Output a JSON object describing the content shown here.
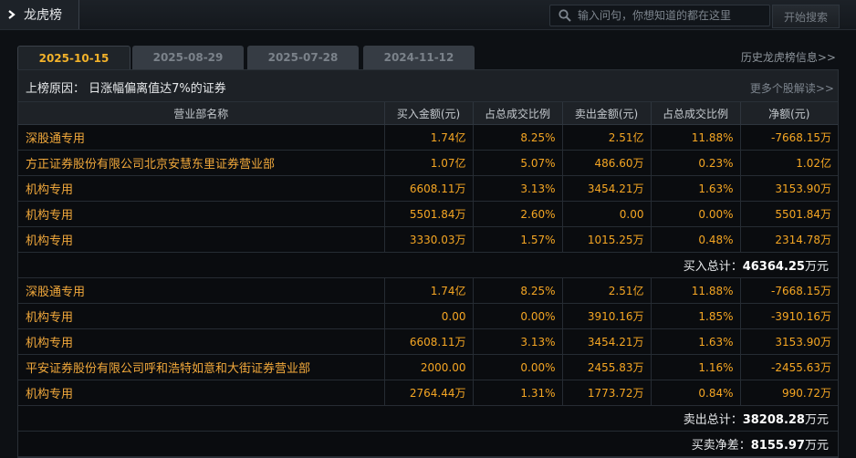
{
  "header": {
    "title": "龙虎榜",
    "search_placeholder": "输入问句，你想知道的都在这里",
    "search_button": "开始搜索"
  },
  "tabs": [
    {
      "label": "2025-10-15",
      "active": true
    },
    {
      "label": "2025-08-29",
      "active": false
    },
    {
      "label": "2025-07-28",
      "active": false
    },
    {
      "label": "2024-11-12",
      "active": false
    }
  ],
  "history_link": "历史龙虎榜信息>>",
  "reason": "上榜原因： 日涨幅偏离值达7%的证券",
  "more_link": "更多个股解读>>",
  "columns": [
    "营业部名称",
    "买入金额(元)",
    "占总成交比例",
    "卖出金额(元)",
    "占总成交比例",
    "净额(元)"
  ],
  "buy_rows": [
    {
      "name": "深股通专用",
      "buy": "1.74亿",
      "buy_pct": "8.25%",
      "sell": "2.51亿",
      "sell_pct": "11.88%",
      "net": "-7668.15万"
    },
    {
      "name": "方正证券股份有限公司北京安慧东里证券营业部",
      "buy": "1.07亿",
      "buy_pct": "5.07%",
      "sell": "486.60万",
      "sell_pct": "0.23%",
      "net": "1.02亿"
    },
    {
      "name": "机构专用",
      "buy": "6608.11万",
      "buy_pct": "3.13%",
      "sell": "3454.21万",
      "sell_pct": "1.63%",
      "net": "3153.90万"
    },
    {
      "name": "机构专用",
      "buy": "5501.84万",
      "buy_pct": "2.60%",
      "sell": "0.00",
      "sell_pct": "0.00%",
      "net": "5501.84万"
    },
    {
      "name": "机构专用",
      "buy": "3330.03万",
      "buy_pct": "1.57%",
      "sell": "1015.25万",
      "sell_pct": "0.48%",
      "net": "2314.78万"
    }
  ],
  "buy_total": {
    "label": "买入总计：",
    "value": "46364.25",
    "unit": "万元"
  },
  "sell_rows": [
    {
      "name": "深股通专用",
      "buy": "1.74亿",
      "buy_pct": "8.25%",
      "sell": "2.51亿",
      "sell_pct": "11.88%",
      "net": "-7668.15万"
    },
    {
      "name": "机构专用",
      "buy": "0.00",
      "buy_pct": "0.00%",
      "sell": "3910.16万",
      "sell_pct": "1.85%",
      "net": "-3910.16万"
    },
    {
      "name": "机构专用",
      "buy": "6608.11万",
      "buy_pct": "3.13%",
      "sell": "3454.21万",
      "sell_pct": "1.63%",
      "net": "3153.90万"
    },
    {
      "name": "平安证券股份有限公司呼和浩特如意和大街证券营业部",
      "buy": "2000.00",
      "buy_pct": "0.00%",
      "sell": "2455.83万",
      "sell_pct": "1.16%",
      "net": "-2455.63万"
    },
    {
      "name": "机构专用",
      "buy": "2764.44万",
      "buy_pct": "1.31%",
      "sell": "1773.72万",
      "sell_pct": "0.84%",
      "net": "990.72万"
    }
  ],
  "sell_total": {
    "label": "卖出总计：",
    "value": "38208.28",
    "unit": "万元"
  },
  "net_total": {
    "label": "买卖净差：",
    "value": "8155.97",
    "unit": "万元"
  },
  "icons": {
    "title_arrow": "chevron-right-icon",
    "search": "search-icon"
  },
  "colors": {
    "accent": "#f5a623",
    "tab_active": "#f2b22a",
    "background": "#0d1014"
  }
}
